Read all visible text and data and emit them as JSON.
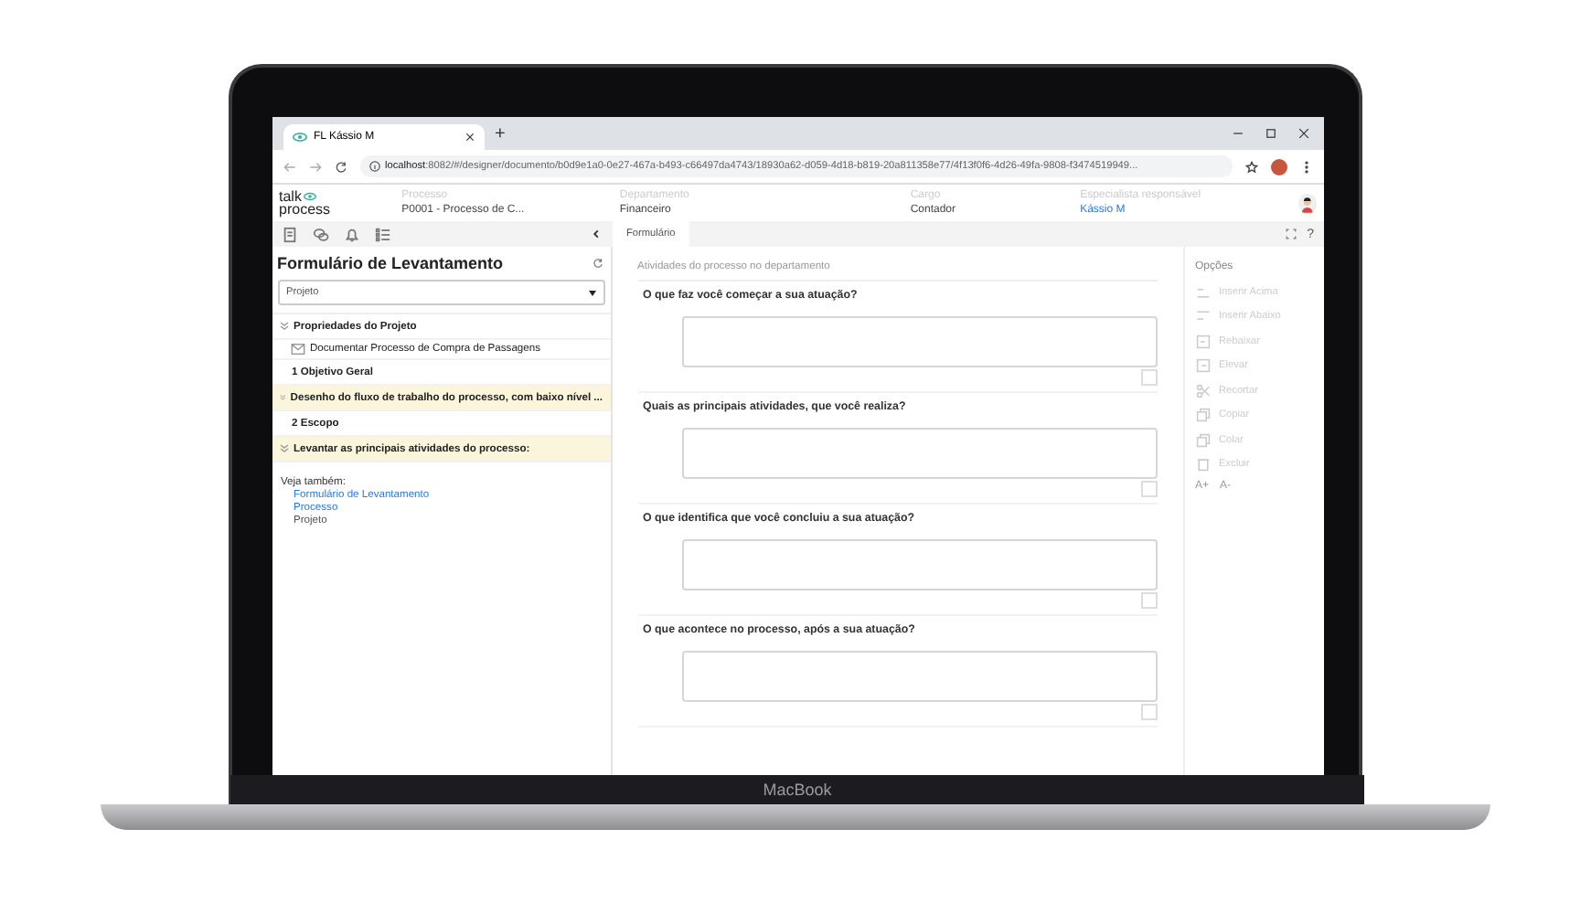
{
  "device": {
    "label": "MacBook"
  },
  "browser": {
    "tab_title": "FL Kássio M",
    "new_tab": "+",
    "url_host": "localhost",
    "url_rest": ":8082/#/designer/documento/b0d9e1a0-0e27-467a-b493-c66497da4743/18930a62-d059-4d18-b819-20a811358e77/4f13f0f6-4d26-49fa-9808-f3474519949..."
  },
  "header": {
    "logo_top": "talk",
    "logo_bottom": "process",
    "fields": [
      {
        "label": "Processo",
        "value": "P0001 - Processo de C...",
        "kind": "text"
      },
      {
        "label": "Departamento",
        "value": "Financeiro",
        "kind": "text"
      },
      {
        "label": "Cargo",
        "value": "Contador",
        "kind": "text"
      },
      {
        "label": "Especialista responsável",
        "value": "Kássio M",
        "kind": "link"
      }
    ]
  },
  "toolbar": {
    "tabs": [
      {
        "label": "Formulário",
        "selected": true
      }
    ],
    "help": "?"
  },
  "sidebar": {
    "title": "Formulário de Levantamento",
    "select": "Projeto",
    "items": [
      {
        "kind": "section",
        "label": "Propriedades do Projeto",
        "expanded": true,
        "highlighted": false,
        "children": [
          {
            "kind": "doc",
            "label": "Documentar Processo de Compra de Passagens"
          }
        ]
      },
      {
        "kind": "item",
        "label": "1 Objetivo Geral"
      },
      {
        "kind": "section",
        "label": "Desenho do fluxo de trabalho do processo, com baixo nível ...",
        "expanded": true,
        "highlighted": true
      },
      {
        "kind": "item",
        "label": "2 Escopo"
      },
      {
        "kind": "section",
        "label": "Levantar as principais atividades do processo:",
        "expanded": true,
        "highlighted": true
      }
    ],
    "see_also": {
      "label": "Veja também:",
      "links": [
        {
          "label": "Formulário de Levantamento",
          "kind": "link"
        },
        {
          "label": "Processo",
          "kind": "link"
        },
        {
          "label": "Projeto",
          "kind": "text"
        }
      ]
    }
  },
  "form": {
    "subtitle": "Atividades do processo no departamento",
    "questions": [
      "O que faz você começar a sua atuação?",
      "Quais as principais atividades, que você realiza?",
      "O que identifica que você concluiu a sua atuação?",
      "O que acontece no processo, após a sua atuação?"
    ]
  },
  "options": {
    "title": "Opções",
    "items": [
      {
        "kind": "insert-above",
        "label": "Inserir Acima",
        "disabled": true
      },
      {
        "kind": "insert-below",
        "label": "Inserir Abaixo",
        "disabled": true
      },
      {
        "kind": "demote",
        "label": "Rebaixar",
        "disabled": true
      },
      {
        "kind": "promote",
        "label": "Elevar",
        "disabled": true
      },
      {
        "kind": "cut",
        "label": "Recortar",
        "disabled": true
      },
      {
        "kind": "copy",
        "label": "Copiar",
        "disabled": true
      },
      {
        "kind": "paste",
        "label": "Colar",
        "disabled": true
      },
      {
        "kind": "delete",
        "label": "Excluir",
        "disabled": true
      }
    ],
    "font_buttons": [
      "A+",
      "A-"
    ]
  }
}
